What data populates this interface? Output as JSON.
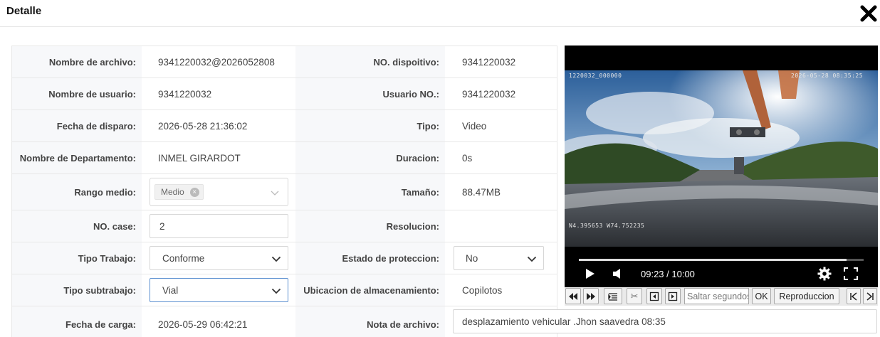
{
  "header": {
    "title": "Detalle"
  },
  "fields": {
    "nombre_archivo": {
      "label": "Nombre de archivo:",
      "value": "9341220032@2026052808"
    },
    "no_dispositivo": {
      "label": "NO. dispoitivo:",
      "value": "9341220032"
    },
    "nombre_usuario": {
      "label": "Nombre de usuario:",
      "value": "9341220032"
    },
    "usuario_no": {
      "label": "Usuario NO.:",
      "value": "9341220032"
    },
    "fecha_disparo": {
      "label": "Fecha de disparo:",
      "value": "2026-05-28 21:36:02"
    },
    "tipo": {
      "label": "Tipo:",
      "value": "Video"
    },
    "departamento": {
      "label": "Nombre de Departamento:",
      "value": "INMEL GIRARDOT"
    },
    "duracion": {
      "label": "Duracion:",
      "value": "0s"
    },
    "rango_medio": {
      "label": "Rango medio:",
      "tag": "Medio"
    },
    "tamano": {
      "label": "Tamaño:",
      "value": "88.47MB"
    },
    "no_case": {
      "label": "NO. case:",
      "value": "2"
    },
    "resolucion": {
      "label": "Resolucion:",
      "value": ""
    },
    "tipo_trabajo": {
      "label": "Tipo Trabajo:",
      "value": "Conforme"
    },
    "estado_proteccion": {
      "label": "Estado de proteccion:",
      "value": "No"
    },
    "tipo_subtrabajo": {
      "label": "Tipo subtrabajo:",
      "value": "Vial"
    },
    "ubicacion": {
      "label": "Ubicacion de almacenamiento:",
      "value": "Copilotos"
    },
    "fecha_carga": {
      "label": "Fecha de carga:",
      "value": "2026-05-29 06:42:21"
    },
    "nota_archivo": {
      "label": "Nota de archivo:",
      "value": "desplazamiento vehicular .Jhon saavedra 08:35"
    }
  },
  "player": {
    "overlay_device": "1220032_000000",
    "overlay_datetime": "2026-05-28 08:35:25",
    "overlay_gps": "N4.395653 W74.752235",
    "time_display": "09:23 / 10:00",
    "progress": 0.94
  },
  "toolbar": {
    "seek_placeholder": "Saltar segundos",
    "ok_label": "OK",
    "playback_label": "Reproduccion"
  },
  "colors": {
    "focus_border": "#5b8fd0",
    "label_bg": "#f7f8fa",
    "border": "#e8e8e8"
  }
}
